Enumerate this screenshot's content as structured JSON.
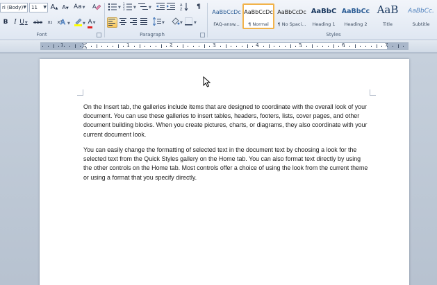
{
  "ribbon": {
    "font_group": {
      "label": "Font",
      "font_name": "ri (Body)",
      "font_size": "11",
      "grow_font": "A",
      "shrink_font": "A",
      "change_case": "Aa",
      "bold": "B",
      "italic": "I",
      "underline": "U",
      "strikethrough": "abe",
      "subscript": "x₂",
      "superscript": "x²",
      "font_color": "A"
    },
    "paragraph_group": {
      "label": "Paragraph",
      "show_hide": "¶"
    },
    "styles_group": {
      "label": "Styles",
      "tiles": [
        {
          "preview": "AaBbCcDc",
          "name": "FAQ-answ..."
        },
        {
          "preview": "AaBbCcDc",
          "name": "¶ Normal"
        },
        {
          "preview": "AaBbCcDc",
          "name": "¶ No Spaci..."
        },
        {
          "preview": "AaBbC",
          "name": "Heading 1"
        },
        {
          "preview": "AaBbCc",
          "name": "Heading 2"
        },
        {
          "preview": "AaB",
          "name": "Title"
        },
        {
          "preview": "AaBbCc.",
          "name": "Subtitle"
        }
      ]
    }
  },
  "ruler": {
    "numbers": [
      "1",
      "1",
      "2",
      "3",
      "4",
      "5",
      "6",
      "7"
    ]
  },
  "document": {
    "paragraphs": [
      "On the Insert tab, the galleries include items that are designed to coordinate with the overall look of your document. You can use these galleries to insert tables, headers, footers, lists, cover pages, and other document building blocks. When you create pictures, charts, or diagrams, they also coordinate with your current document look.",
      "You can easily change the formatting of selected text in the document text by choosing a look for the selected text from the Quick Styles gallery on the Home tab. You can also format text directly by using the other controls on the Home tab. Most controls offer a choice of using the look from the current theme or using a format that you specify directly."
    ]
  },
  "colors": {
    "highlight": "#ffff00",
    "font_color": "#e02020",
    "selected_style_border": "#f2b34a",
    "page": "#ffffff"
  }
}
